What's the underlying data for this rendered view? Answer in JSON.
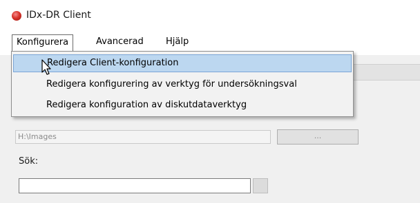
{
  "window": {
    "title": "IDx-DR Client"
  },
  "menubar": {
    "items": [
      "Konfigurera",
      "Avancerad",
      "Hjälp"
    ]
  },
  "dropdown": {
    "items": [
      "Redigera Client-konfiguration",
      "Redigera konfigurering av verktyg för undersökningsval",
      "Redigera konfiguration av diskutdataverktyg"
    ]
  },
  "form": {
    "path_value": "H:\\Images",
    "browse_label": "...",
    "search_label": "Sök:",
    "search_value": ""
  },
  "colors": {
    "menu_highlight": "#bcd7f0",
    "app_icon": "#d9342c"
  },
  "icons": {
    "app_icon": "app-icon",
    "cursor": "mouse-cursor-icon"
  }
}
